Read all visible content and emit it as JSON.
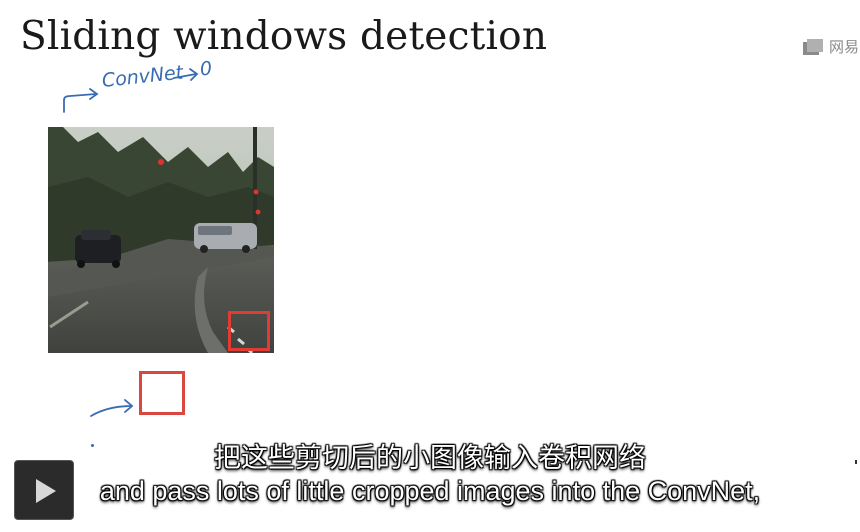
{
  "slide": {
    "title": "Sliding windows detection",
    "watermark": "网易"
  },
  "annotations": {
    "convnet_label": "ConvNet",
    "output_label": "0"
  },
  "image": {
    "description_icon": "street-scene-photo",
    "window_color": "#e23b33"
  },
  "player": {
    "play_icon": "play-icon"
  },
  "subtitles": {
    "chinese": "把这些剪切后的小图像输入卷积网络",
    "english": "and pass lots of little cropped images into the ConvNet,"
  },
  "colors": {
    "ink": "#3a6cb0",
    "box_red": "#d9473f",
    "subtitle_text": "#ffffff"
  }
}
